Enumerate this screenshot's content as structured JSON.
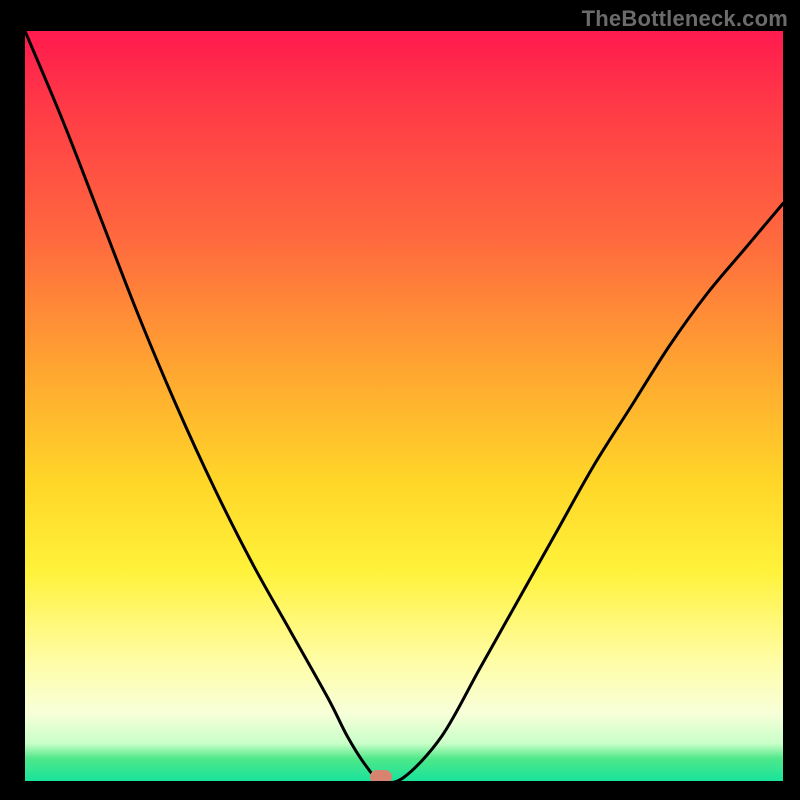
{
  "watermark": "TheBottleneck.com",
  "chart_data": {
    "type": "line",
    "title": "",
    "xlabel": "",
    "ylabel": "",
    "xlim": [
      0,
      100
    ],
    "ylim": [
      0,
      100
    ],
    "series": [
      {
        "name": "bottleneck-curve",
        "x": [
          0,
          5,
          10,
          15,
          20,
          25,
          30,
          35,
          40,
          42.5,
          45,
          47,
          50,
          55,
          60,
          65,
          70,
          75,
          80,
          85,
          90,
          95,
          100
        ],
        "y": [
          100,
          88,
          75,
          62,
          50,
          39,
          29,
          20,
          11,
          6,
          2,
          0,
          0.5,
          6,
          15,
          24,
          33,
          42,
          50,
          58,
          65,
          71,
          77
        ]
      }
    ],
    "valley_point": {
      "x": 47,
      "y": 0
    },
    "gradient_stops": [
      {
        "pct": 0,
        "color": "#ff1a4e"
      },
      {
        "pct": 28,
        "color": "#ff6a3e"
      },
      {
        "pct": 60,
        "color": "#ffd628"
      },
      {
        "pct": 84,
        "color": "#fffda6"
      },
      {
        "pct": 97,
        "color": "#4fe88a"
      },
      {
        "pct": 100,
        "color": "#18e39b"
      }
    ]
  }
}
